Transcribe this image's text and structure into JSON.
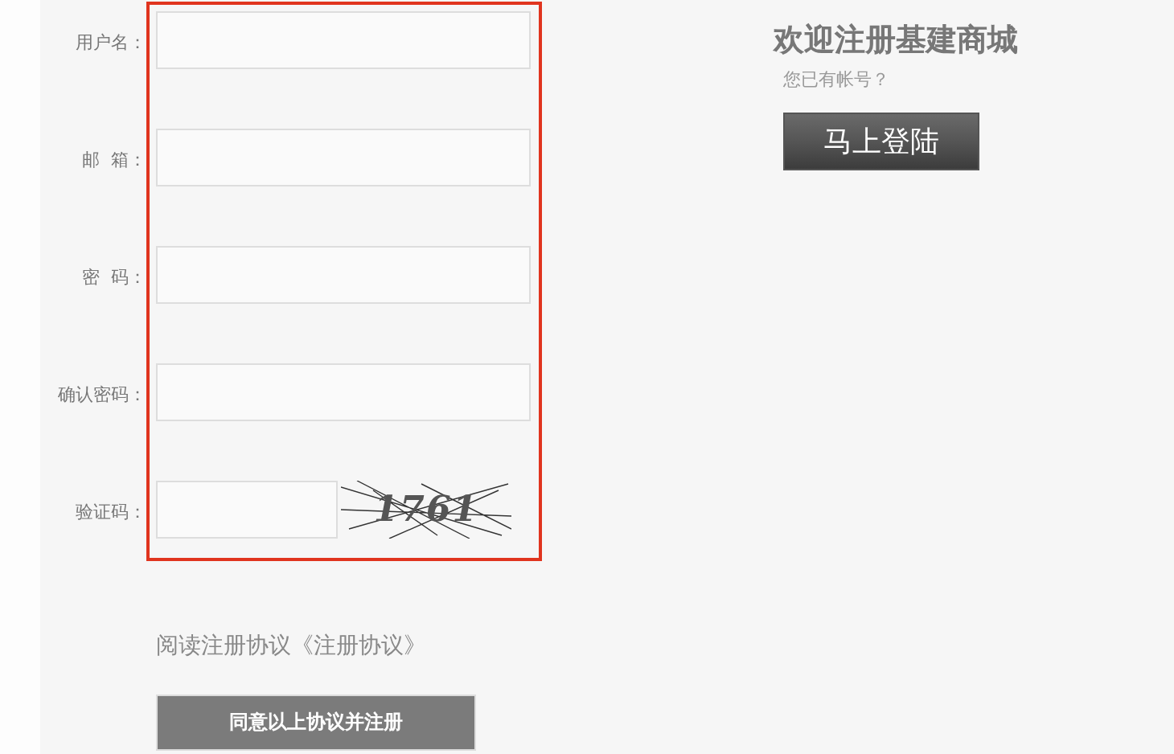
{
  "form": {
    "fields": [
      {
        "label": "用户名：",
        "kind": "text"
      },
      {
        "label": "邮  箱：",
        "kind": "text"
      },
      {
        "label": "密  码：",
        "kind": "text"
      },
      {
        "label": "确认密码：",
        "kind": "text"
      },
      {
        "label": "验证码：",
        "kind": "captcha",
        "captcha": "1761"
      }
    ]
  },
  "agreement_link": "阅读注册协议《注册协议》",
  "submit_button": "同意以上协议并注册",
  "welcome": {
    "title": "欢迎注册基建商城",
    "subtitle": "您已有帐号？",
    "login_button": "马上登陆"
  }
}
